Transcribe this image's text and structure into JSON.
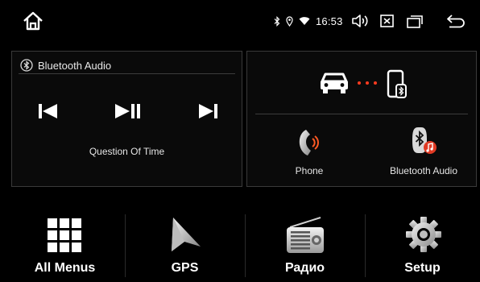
{
  "status_bar": {
    "time": "16:53",
    "icons": [
      "bluetooth-icon",
      "location-icon",
      "wifi-icon",
      "volume-icon",
      "close-box-icon",
      "recent-apps-icon",
      "back-icon"
    ]
  },
  "bluetooth_audio": {
    "title": "Bluetooth Audio",
    "track": "Question Of Time"
  },
  "connection": {
    "buttons": [
      {
        "label": "Phone",
        "icon": "phone-icon"
      },
      {
        "label": "Bluetooth Audio",
        "icon": "bluetooth-music-icon"
      }
    ],
    "link_dot_color": "#ff3b1f"
  },
  "dock": {
    "items": [
      {
        "label": "All Menus",
        "icon": "grid-icon"
      },
      {
        "label": "GPS",
        "icon": "navigation-arrow-icon"
      },
      {
        "label": "Радио",
        "icon": "radio-icon"
      },
      {
        "label": "Setup",
        "icon": "gear-icon"
      }
    ]
  }
}
